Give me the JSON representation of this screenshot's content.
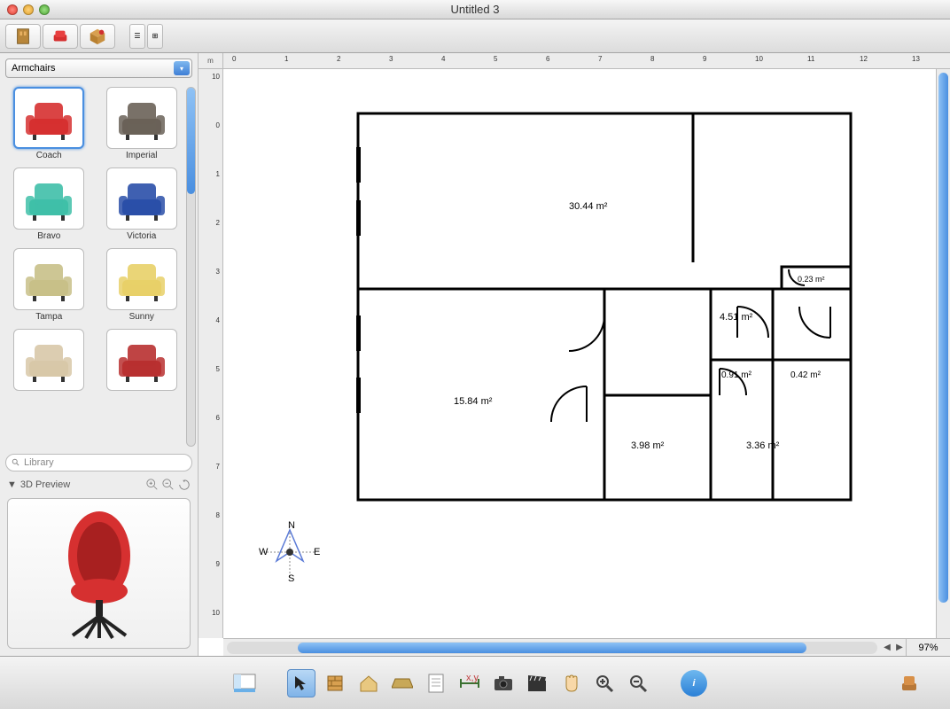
{
  "window": {
    "title": "Untitled 3"
  },
  "toolbar": {
    "buttons": [
      "library-icon",
      "furniture-icon",
      "materials-icon"
    ],
    "list": [
      "list-a",
      "list-b"
    ]
  },
  "sidebar": {
    "category": "Armchairs",
    "items": [
      {
        "label": "Coach",
        "color": "#d63030",
        "selected": true
      },
      {
        "label": "Imperial",
        "color": "#6a6258"
      },
      {
        "label": "Bravo",
        "color": "#3fbfa8"
      },
      {
        "label": "Victoria",
        "color": "#2a4fa8"
      },
      {
        "label": "Tampa",
        "color": "#c8c088"
      },
      {
        "label": "Sunny",
        "color": "#e8d068"
      },
      {
        "label": "",
        "color": "#d8c8a8"
      },
      {
        "label": "",
        "color": "#b83030"
      }
    ],
    "search_placeholder": "Library",
    "preview_title": "3D Preview"
  },
  "canvas": {
    "unit": "m",
    "ruler_h": [
      "0",
      "1",
      "2",
      "3",
      "4",
      "5",
      "6",
      "7",
      "8",
      "9",
      "10",
      "11",
      "12",
      "13"
    ],
    "ruler_v": [
      "10",
      "0",
      "1",
      "2",
      "3",
      "4",
      "5",
      "6",
      "7",
      "8",
      "9",
      "10"
    ],
    "rooms": [
      {
        "area": "30.44 m²"
      },
      {
        "area": "0.23 m²"
      },
      {
        "area": "4.51 m²"
      },
      {
        "area": "15.84 m²"
      },
      {
        "area": "0.91 m²"
      },
      {
        "area": "0.42 m²"
      },
      {
        "area": "3.98 m²"
      },
      {
        "area": "3.36 m²"
      }
    ],
    "zoom": "97%",
    "compass": {
      "n": "N",
      "s": "S",
      "e": "E",
      "w": "W"
    }
  },
  "bottom_toolbar": {
    "buttons": [
      "panel-icon",
      "pointer-icon",
      "wall-icon",
      "room-icon",
      "floor-icon",
      "text-icon",
      "dimension-icon",
      "camera-icon",
      "movie-icon",
      "hand-icon",
      "zoom-in-icon",
      "zoom-out-icon"
    ],
    "info": "i"
  }
}
